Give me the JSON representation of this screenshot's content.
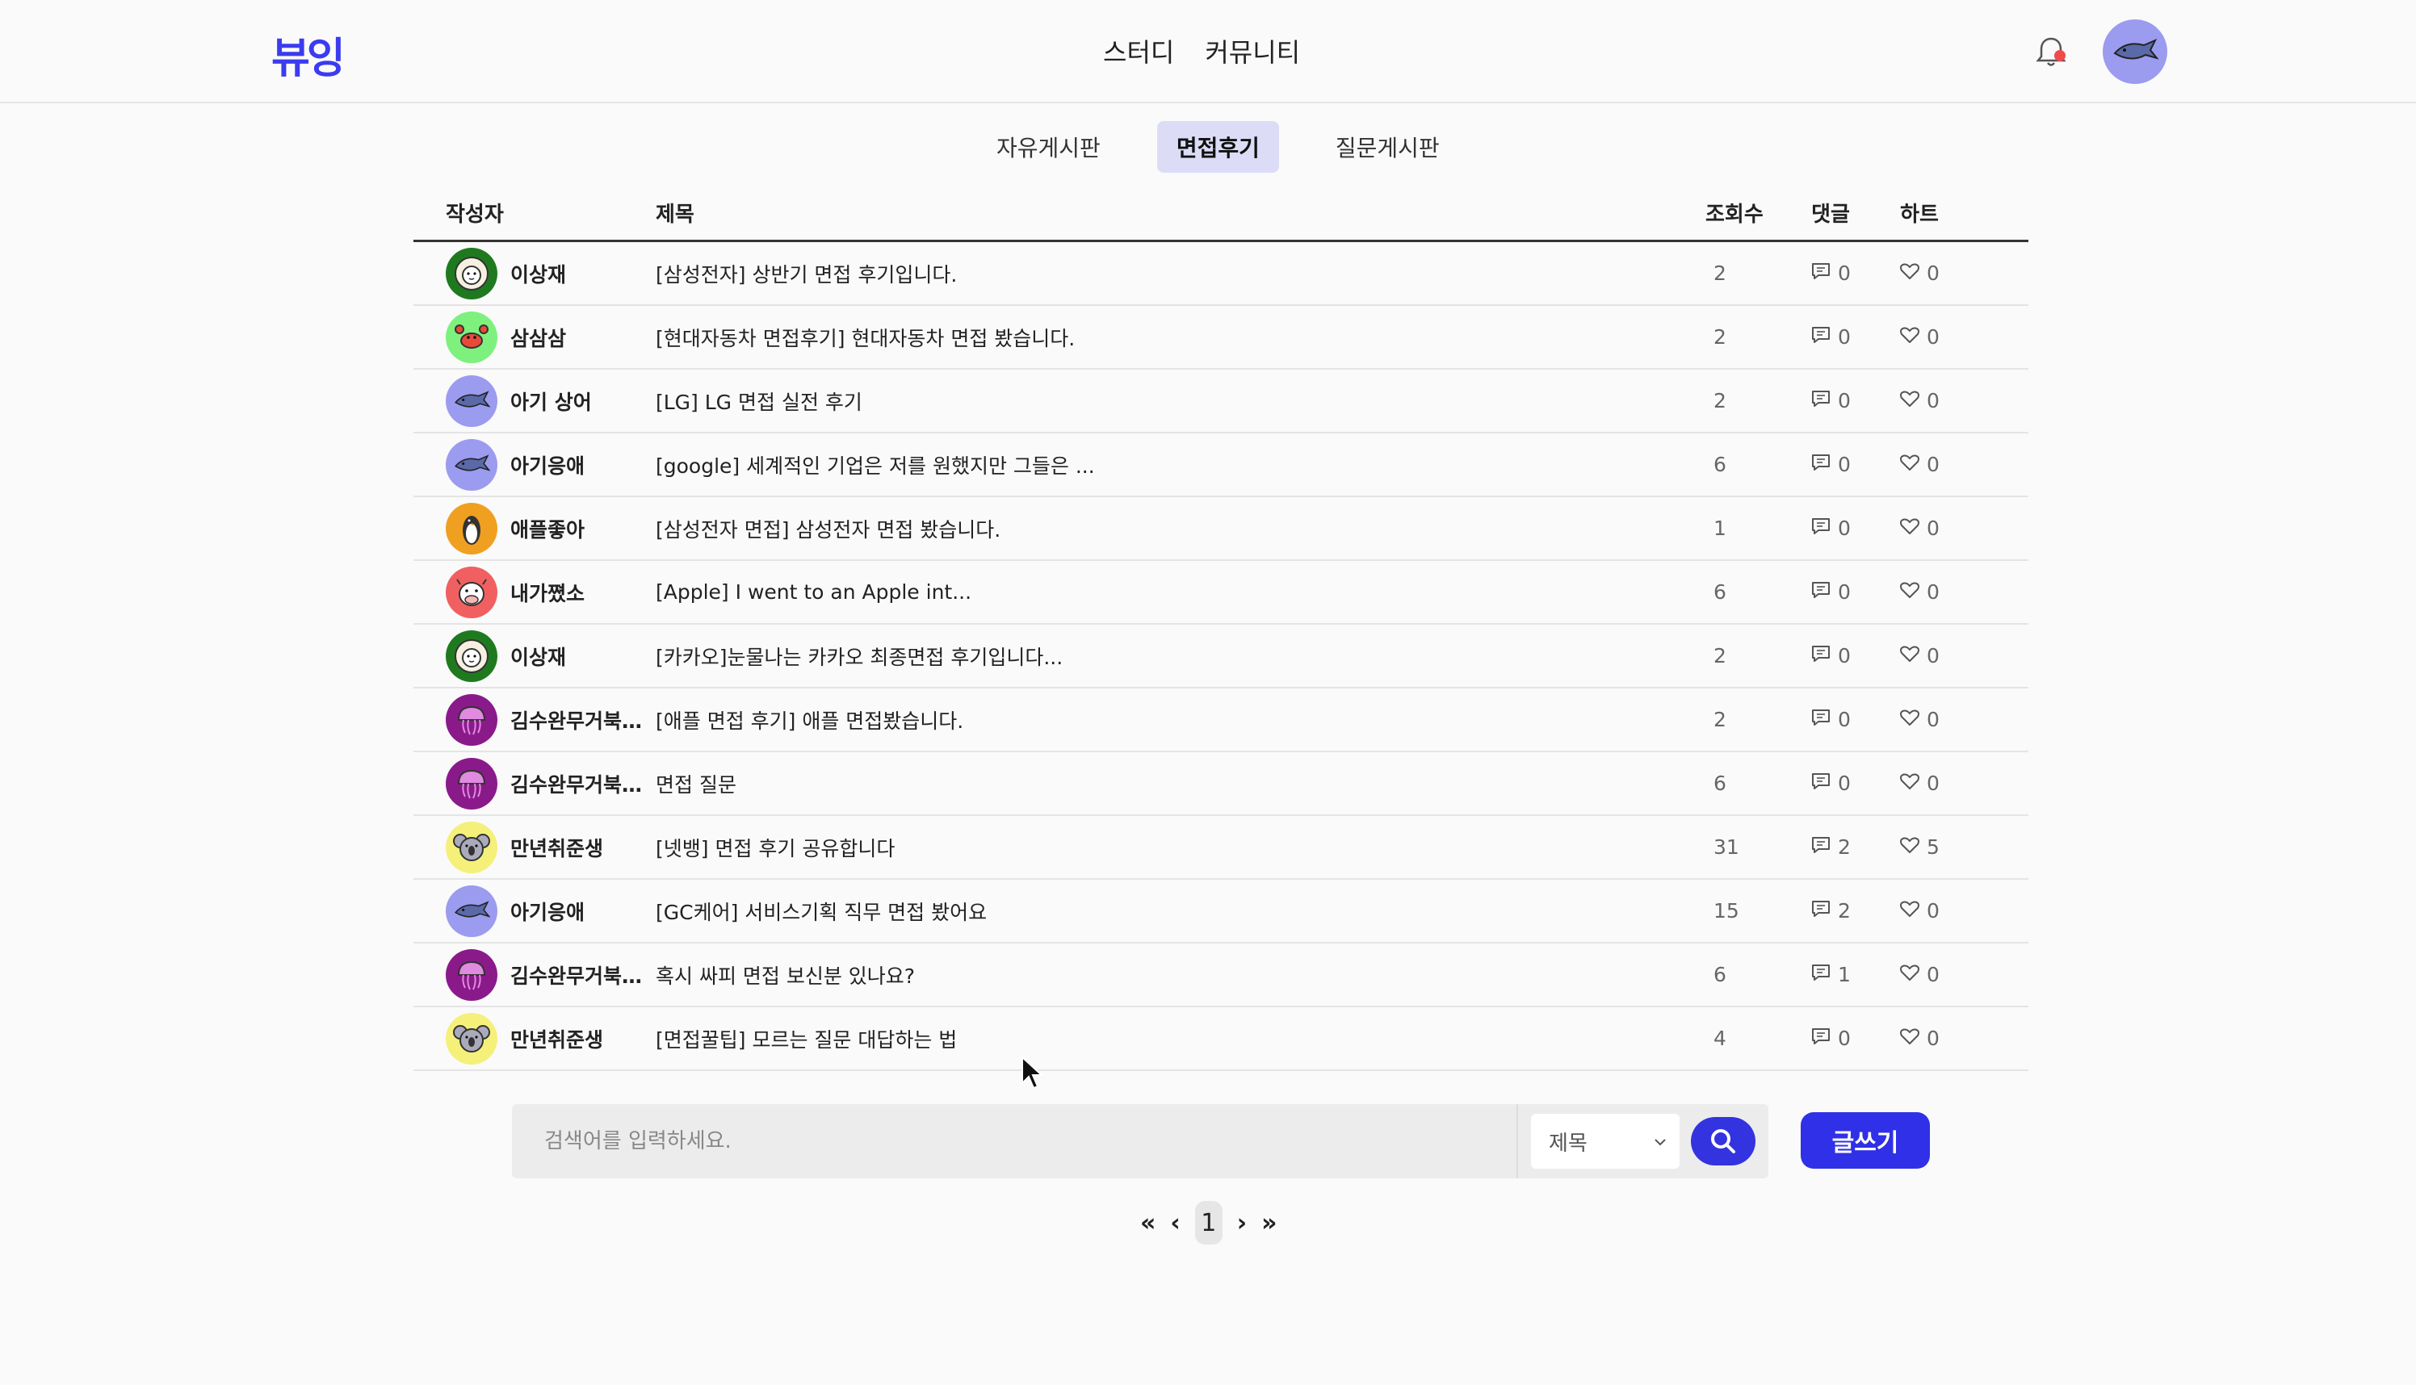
{
  "header": {
    "logo": "뷰잉",
    "nav": [
      "스터디",
      "커뮤니티"
    ]
  },
  "tabs": [
    "자유게시판",
    "면접후기",
    "질문게시판"
  ],
  "active_tab": "면접후기",
  "table": {
    "headers": {
      "author": "작성자",
      "title": "제목",
      "views": "조회수",
      "comments": "댓글",
      "hearts": "하트"
    },
    "rows": [
      {
        "author": "이상재",
        "avatar": "lion",
        "title": "[삼성전자] 상반기 면접 후기입니다.",
        "views": "2",
        "comments": "0",
        "hearts": "0"
      },
      {
        "author": "삼삼삼",
        "avatar": "crab",
        "title": "[현대자동차 면접후기] 현대자동차 면접 봤습니다.",
        "views": "2",
        "comments": "0",
        "hearts": "0"
      },
      {
        "author": "아기 상어",
        "avatar": "shark",
        "title": "[LG] LG 면접 실전 후기",
        "views": "2",
        "comments": "0",
        "hearts": "0"
      },
      {
        "author": "아기응애",
        "avatar": "shark",
        "title": "[google] 세계적인 기업은 저를 원했지만 그들은 ...",
        "views": "6",
        "comments": "0",
        "hearts": "0"
      },
      {
        "author": "애플좋아",
        "avatar": "penguin",
        "title": "[삼성전자 면접] 삼성전자 면접 봤습니다.",
        "views": "1",
        "comments": "0",
        "hearts": "0"
      },
      {
        "author": "내가쪘소",
        "avatar": "cow",
        "title": "[Apple] I went to an Apple int...",
        "views": "6",
        "comments": "0",
        "hearts": "0"
      },
      {
        "author": "이상재",
        "avatar": "lion",
        "title": "[카카오]눈물나는 카카오 최종면접 후기입니다...",
        "views": "2",
        "comments": "0",
        "hearts": "0"
      },
      {
        "author": "김수완무거북이와...",
        "avatar": "jellyfish",
        "title": "[애플 면접 후기] 애플 면접봤습니다.",
        "views": "2",
        "comments": "0",
        "hearts": "0"
      },
      {
        "author": "김수완무거북이와...",
        "avatar": "jellyfish",
        "title": "면접 질문",
        "views": "6",
        "comments": "0",
        "hearts": "0"
      },
      {
        "author": "만년취준생",
        "avatar": "koala",
        "title": "[넷뱅] 면접 후기 공유합니다",
        "views": "31",
        "comments": "2",
        "hearts": "5"
      },
      {
        "author": "아기응애",
        "avatar": "shark",
        "title": "[GC케어] 서비스기획 직무 면접 봤어요",
        "views": "15",
        "comments": "2",
        "hearts": "0"
      },
      {
        "author": "김수완무거북이와...",
        "avatar": "jellyfish",
        "title": "혹시 싸피 면접 보신분 있나요?",
        "views": "6",
        "comments": "1",
        "hearts": "0"
      },
      {
        "author": "만년취준생",
        "avatar": "koala",
        "title": "[면접꿀팁] 모르는 질문 대답하는 법",
        "views": "4",
        "comments": "0",
        "hearts": "0"
      }
    ]
  },
  "search": {
    "placeholder": "검색어를 입력하세요.",
    "filter": "제목"
  },
  "write_button": "글쓰기",
  "pagination": {
    "first": "«",
    "prev": "‹",
    "current": "1",
    "next": "›",
    "last": "»"
  },
  "colors": {
    "accent": "#3030e8",
    "tab_active_bg": "#dcdcf7",
    "notification_dot": "#f04b4b"
  }
}
